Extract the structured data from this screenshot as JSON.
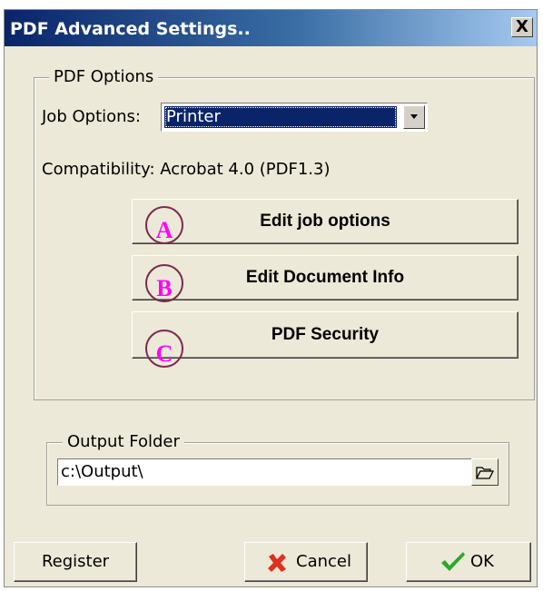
{
  "window": {
    "title": "PDF Advanced Settings..",
    "close_label": "X"
  },
  "pdf_options": {
    "group_title": "PDF Options",
    "job_options_label": "Job Options:",
    "job_options_value": "Printer",
    "compatibility": "Compatibility:  Acrobat 4.0 (PDF1.3)",
    "buttons": [
      {
        "annotation": "A",
        "label": "Edit job options"
      },
      {
        "annotation": "B",
        "label": "Edit Document Info"
      },
      {
        "annotation": "C",
        "label": "PDF Security"
      }
    ]
  },
  "output": {
    "group_title": "Output Folder",
    "path": "c:\\Output\\",
    "browse_icon": "folder-open-icon"
  },
  "footer": {
    "register_label": "Register",
    "cancel_label": "Cancel",
    "ok_label": "OK"
  },
  "colors": {
    "title_bar": "#0a246a",
    "annotation_letter": "#ff00ff",
    "annotation_ring": "#7b2a50",
    "cancel_x": "#e03020",
    "ok_check": "#2aa82a"
  }
}
